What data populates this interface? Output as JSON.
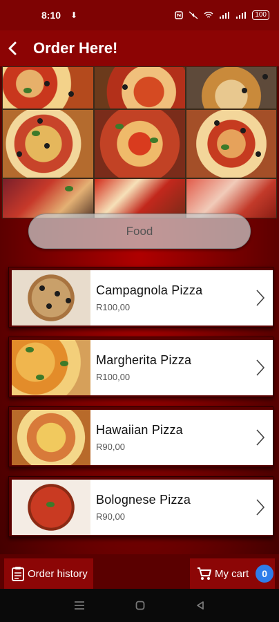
{
  "status_bar": {
    "time": "8:10",
    "battery": "100"
  },
  "header": {
    "title": "Order Here!"
  },
  "category": {
    "label": "Food"
  },
  "items": [
    {
      "name": "Campagnola Pizza",
      "price": "R100,00"
    },
    {
      "name": "Margherita Pizza",
      "price": "R100,00"
    },
    {
      "name": "Hawaiian Pizza",
      "price": "R90,00"
    },
    {
      "name": "Bolognese Pizza",
      "price": "R90,00"
    }
  ],
  "bottom_bar": {
    "order_history_label": "Order history",
    "cart_label": "My cart",
    "cart_count": "0"
  },
  "colors": {
    "brand": "#8c0404",
    "badge": "#2f7dea"
  },
  "icons": [
    "back-arrow-icon",
    "clipboard-icon",
    "cart-icon",
    "chevron-right-icon"
  ]
}
